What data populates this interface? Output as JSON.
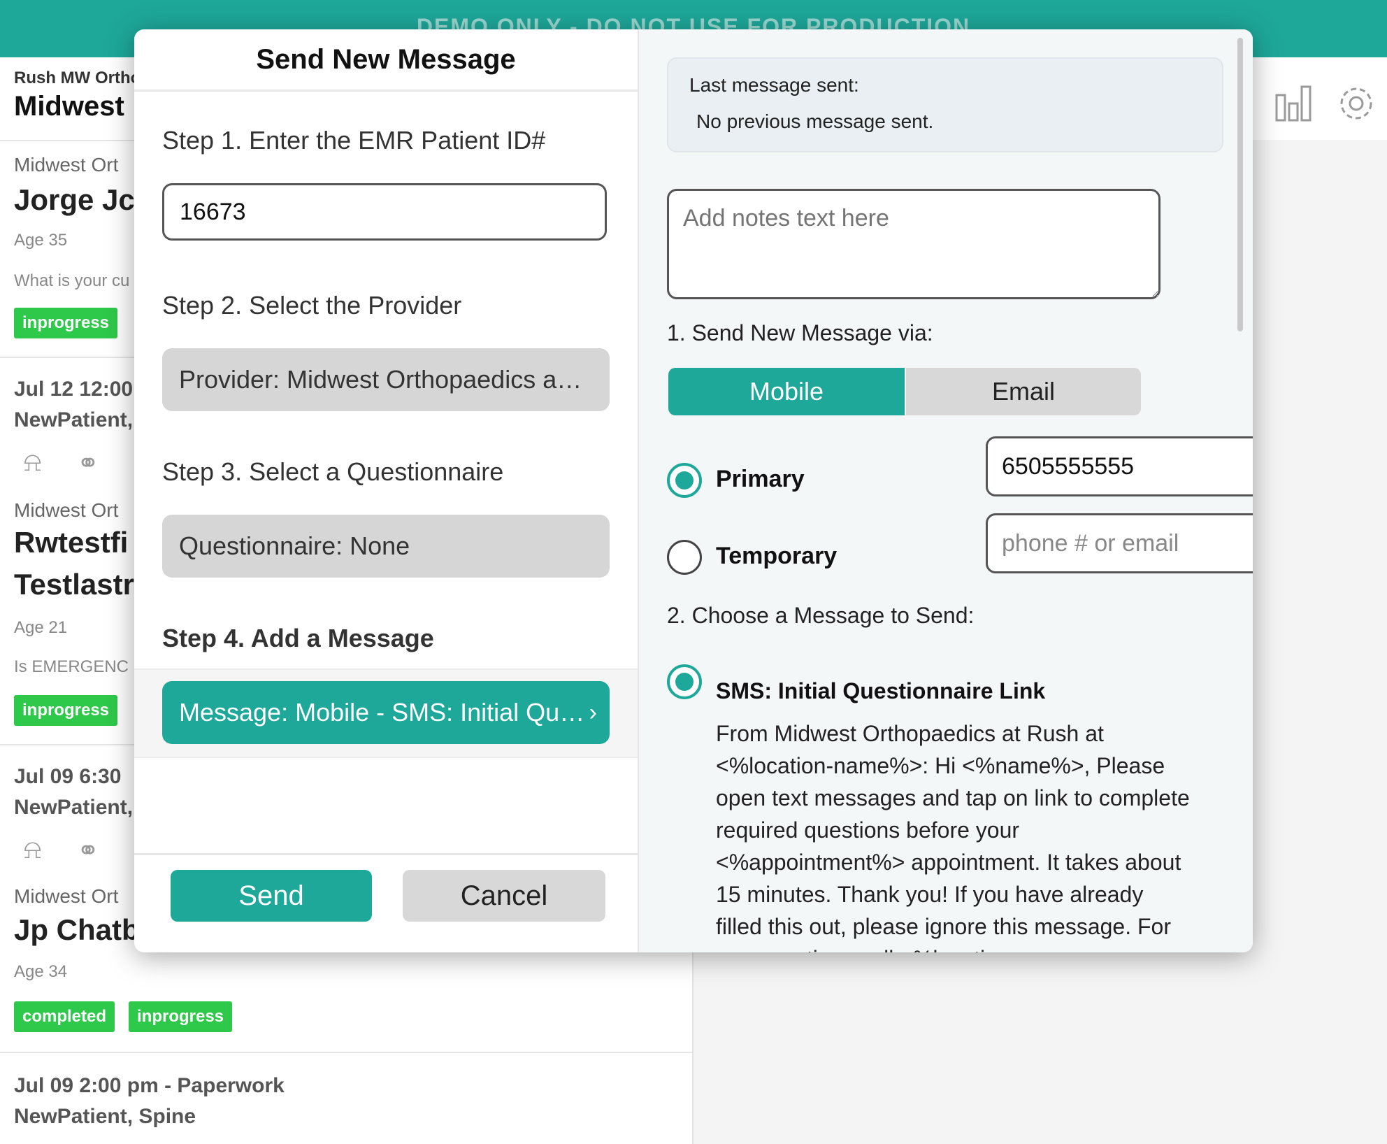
{
  "banner": {
    "text": "DEMO ONLY - DO NOT USE FOR PRODUCTION"
  },
  "header": {
    "org_sub": "Rush MW Ortho",
    "org_title": "Midwest"
  },
  "background_list": {
    "items": [
      {
        "org": "Midwest Ort",
        "name": "Jorge Jc",
        "age": "Age 35",
        "question": "What is your cu",
        "badge": "inprogress"
      },
      {
        "date": "Jul 12 12:00",
        "type": "NewPatient,"
      },
      {
        "org": "Midwest Ort",
        "name": "Rwtestfi",
        "name2": "Testlastr",
        "age": "Age 21",
        "question": "Is EMERGENC",
        "badge": "inprogress"
      },
      {
        "date": "Jul 09 6:30",
        "type": "NewPatient,"
      },
      {
        "org": "Midwest Ort",
        "name": "Jp Chatb",
        "age": "Age 34",
        "badge1": "completed",
        "badge2": "inprogress"
      },
      {
        "date": "Jul 09 2:00 pm - Paperwork",
        "type": "NewPatient, Spine"
      }
    ]
  },
  "modal": {
    "title": "Send New Message",
    "step1": {
      "label": "Step 1. Enter the EMR Patient ID#",
      "value": "16673"
    },
    "step2": {
      "label": "Step 2. Select the Provider",
      "value": "Provider: Midwest Orthopaedics a…"
    },
    "step3": {
      "label": "Step 3. Select a Questionnaire",
      "value": "Questionnaire: None"
    },
    "step4": {
      "label": "Step 4. Add a Message",
      "value": "Message: Mobile - SMS: Initial Qu…"
    },
    "send_label": "Send",
    "cancel_label": "Cancel",
    "last_message": {
      "label": "Last message sent:",
      "value": "No previous message sent."
    },
    "notes_placeholder": "Add notes text here",
    "send_via": {
      "label": "1. Send New Message via:",
      "options": [
        "Mobile",
        "Email"
      ],
      "selected": "Mobile"
    },
    "primary": {
      "label": "Primary",
      "value": "6505555555",
      "selected": true
    },
    "temporary": {
      "label": "Temporary",
      "placeholder": "phone # or email",
      "selected": false
    },
    "choose_message": {
      "label": "2. Choose a Message to Send:",
      "option_title": "SMS: Initial Questionnaire Link",
      "option_body": "From Midwest Orthopaedics at Rush at <%location-name%>: Hi <%name%>, Please open text messages and tap on link to complete required questions before your <%appointment%> appointment. It takes about 15 minutes. Thank you! If you have already filled this out, please ignore this message. For any questions call <%location-"
    }
  },
  "colors": {
    "accent": "#1ea89a",
    "badge_green": "#2ec84a"
  }
}
